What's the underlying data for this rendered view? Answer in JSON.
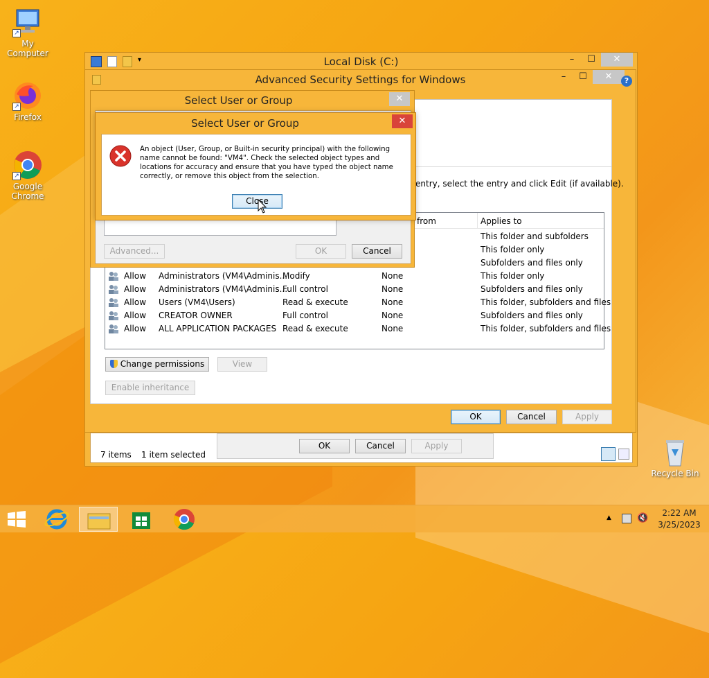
{
  "desktop": {
    "icons": [
      {
        "label": "My Computer"
      },
      {
        "label": "Firefox"
      },
      {
        "label": "Google Chrome"
      },
      {
        "label": "Recycle Bin"
      }
    ]
  },
  "explorer": {
    "title": "Local Disk (C:)",
    "status_items": "7 items",
    "status_selected": "1 item selected",
    "ok": "OK",
    "cancel": "Cancel",
    "apply": "Apply"
  },
  "advanced": {
    "title": "Advanced Security Settings for Windows",
    "instruction": "entry, select the entry and click Edit (if available).",
    "columns": {
      "from": "from",
      "applies_to": "Applies to"
    },
    "partial_rows": [
      "This folder and subfolders",
      "This folder only",
      "Subfolders and files only"
    ],
    "rows": [
      {
        "type": "Allow",
        "principal": "Administrators (VM4\\Adminis...",
        "access": "Modify",
        "inherited": "None",
        "applies": "This folder only"
      },
      {
        "type": "Allow",
        "principal": "Administrators (VM4\\Adminis...",
        "access": "Full control",
        "inherited": "None",
        "applies": "Subfolders and files only"
      },
      {
        "type": "Allow",
        "principal": "Users (VM4\\Users)",
        "access": "Read & execute",
        "inherited": "None",
        "applies": "This folder, subfolders and files"
      },
      {
        "type": "Allow",
        "principal": "CREATOR OWNER",
        "access": "Full control",
        "inherited": "None",
        "applies": "Subfolders and files only"
      },
      {
        "type": "Allow",
        "principal": "ALL APPLICATION PACKAGES",
        "access": "Read & execute",
        "inherited": "None",
        "applies": "This folder, subfolders and files"
      }
    ],
    "change_permissions": "Change permissions",
    "view": "View",
    "enable_inheritance": "Enable inheritance",
    "ok": "OK",
    "cancel": "Cancel",
    "apply": "Apply"
  },
  "select_user": {
    "title": "Select User or Group",
    "advanced": "Advanced...",
    "ok": "OK",
    "cancel": "Cancel"
  },
  "error": {
    "title": "Select User or Group",
    "message": "An object (User, Group, or Built-in security principal) with the following name cannot be found: \"VM4\". Check the selected object types and locations for accuracy and ensure that you have typed the object name correctly, or remove this object from the selection.",
    "close": "Close"
  },
  "taskbar": {
    "time": "2:22 AM",
    "date": "3/25/2023"
  }
}
